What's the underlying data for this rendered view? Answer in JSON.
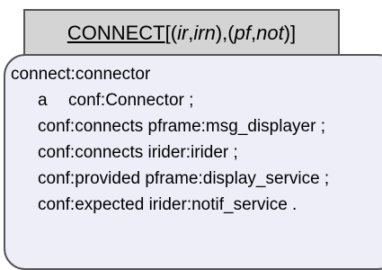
{
  "header": {
    "name": "CONNECT",
    "open_bracket": "[(",
    "ir": "ir",
    "comma1": ",",
    "irn": "irn",
    "mid": "),(",
    "pf": "pf",
    "comma2": ",",
    "not": "not",
    "close": ")]"
  },
  "body": {
    "subject": "connect:connector",
    "type_keyword": "a",
    "type_value": "conf:Connector ;",
    "lines": [
      "conf:connects pframe:msg_displayer ;",
      "conf:connects irider:irider ;",
      "conf:provided pframe:display_service ;",
      "conf:expected irider:notif_service ."
    ]
  }
}
